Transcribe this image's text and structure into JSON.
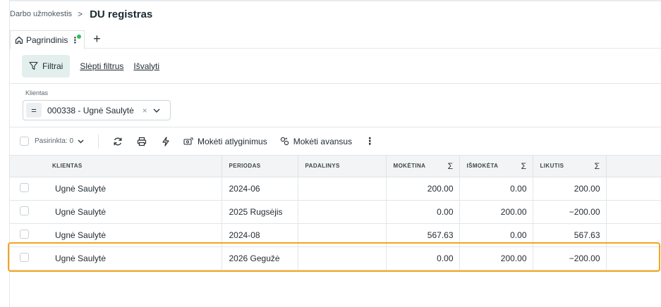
{
  "breadcrumb": {
    "parent": "Darbo užmokestis",
    "separator": ">",
    "title": "DU registras"
  },
  "tabs": [
    {
      "label": "Pagrindinis",
      "menu_glyph": "⋮",
      "status_color": "#2fbf5b"
    }
  ],
  "add_tab_glyph": "+",
  "filter_toolbar": {
    "filter_button": "Filtrai",
    "hide_filters": "Slėpti filtrus",
    "clear": "Išvalyti"
  },
  "filter_panel": {
    "client_label": "Klientas",
    "operator": "=",
    "client_value": "000338 - Ugnė Saulytė",
    "clear_glyph": "×"
  },
  "action_toolbar": {
    "selected_label": "Pasirinkta: 0",
    "pay_salary": "Mokėti atlyginimus",
    "pay_advance": "Mokėti avansus",
    "more_glyph": "⋮"
  },
  "table": {
    "columns": [
      "KLIENTAS",
      "PERIODAS",
      "PADALINYS",
      "MOKĖTINA",
      "IŠMOKĖTA",
      "LIKUTIS"
    ],
    "sigma": "Σ",
    "rows": [
      {
        "klientas": "Ugnė Saulytė",
        "periodas": "2024-06",
        "padalinys": "",
        "moketina": "200.00",
        "ismoketa": "0.00",
        "likutis": "200.00"
      },
      {
        "klientas": "Ugnė Saulytė",
        "periodas": "2025 Rugsėjis",
        "padalinys": "",
        "moketina": "0.00",
        "ismoketa": "200.00",
        "likutis": "−200.00"
      },
      {
        "klientas": "Ugnė Saulytė",
        "periodas": "2024-08",
        "padalinys": "",
        "moketina": "567.63",
        "ismoketa": "0.00",
        "likutis": "567.63"
      },
      {
        "klientas": "Ugnė Saulytė",
        "periodas": "2026 Gegužė",
        "padalinys": "",
        "moketina": "0.00",
        "ismoketa": "200.00",
        "likutis": "−200.00"
      }
    ]
  },
  "colors": {
    "accent_bg": "#e3efed",
    "highlight": "#f3a51f",
    "header_bg": "#f2f4f5"
  }
}
